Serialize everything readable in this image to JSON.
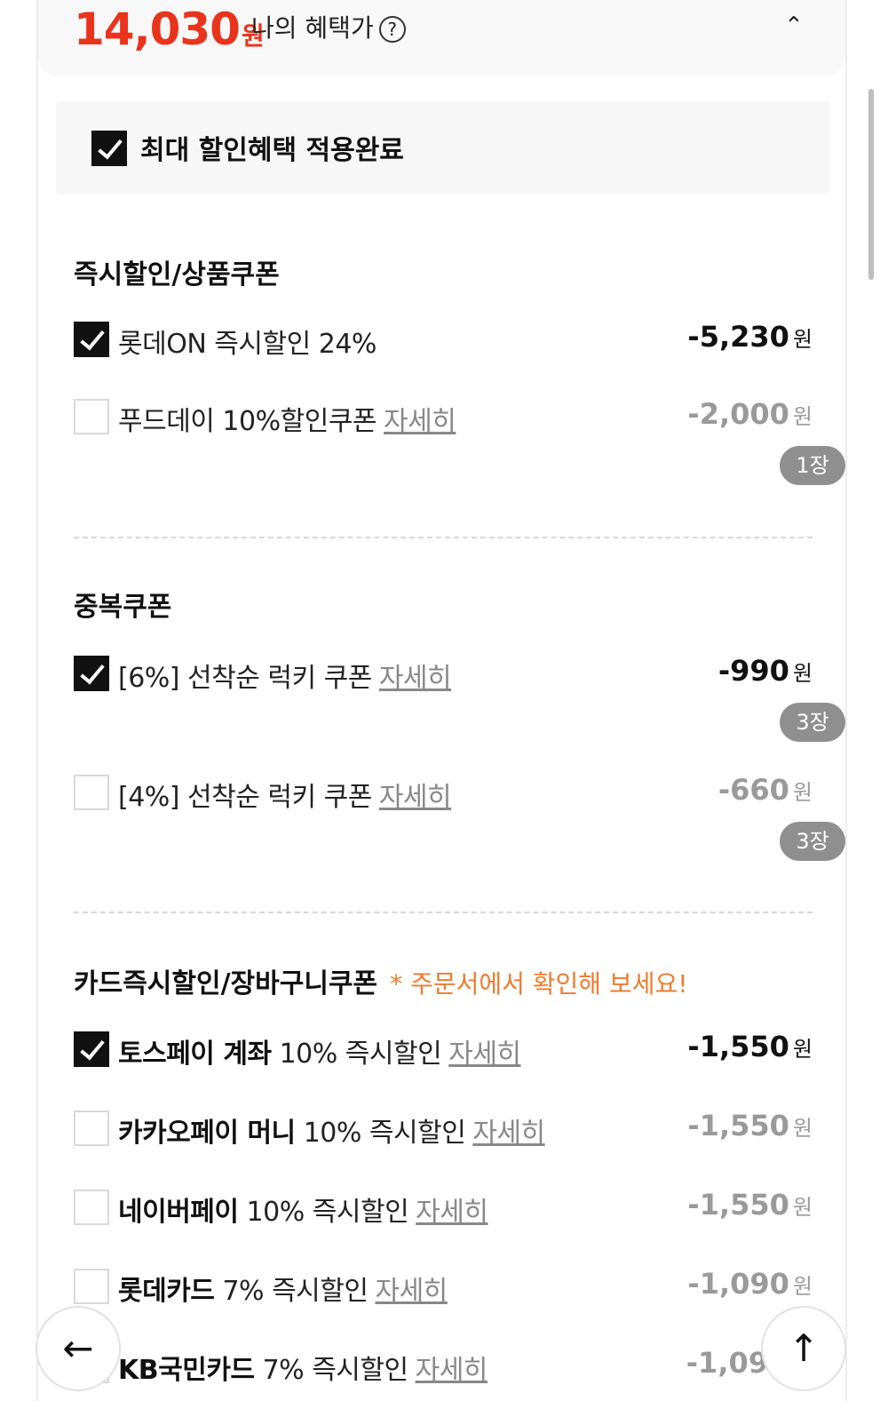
{
  "summary": {
    "price": "14,030",
    "price_unit": "원",
    "benefit_label": "나의 혜택가",
    "help_icon": "?",
    "collapse_icon": "⌃"
  },
  "max_benefit": {
    "label": "최대 할인혜택 적용완료",
    "checked": true
  },
  "sections": {
    "instant": {
      "title": "즉시할인/상품쿠폰",
      "items": [
        {
          "label": "롯데ON 즉시할인 24%",
          "amount": "-5,230",
          "unit": "원",
          "checked": true
        },
        {
          "label": "푸드데이 10%할인쿠폰",
          "detail": "자세히",
          "amount": "-2,000",
          "unit": "원",
          "checked": false,
          "qty": "1장"
        }
      ]
    },
    "duplicate": {
      "title": "중복쿠폰",
      "items": [
        {
          "label": "[6%] 선착순 럭키 쿠폰",
          "detail": "자세히",
          "amount": "-990",
          "unit": "원",
          "checked": true,
          "qty": "3장"
        },
        {
          "label": "[4%] 선착순 럭키 쿠폰",
          "detail": "자세히",
          "amount": "-660",
          "unit": "원",
          "checked": false,
          "qty": "3장"
        }
      ]
    },
    "card": {
      "title": "카드즉시할인/장바구니쿠폰",
      "note": "* 주문서에서 확인해 보세요!",
      "items": [
        {
          "brand": "토스페이 계좌",
          "label": "10% 즉시할인",
          "detail": "자세히",
          "amount": "-1,550",
          "unit": "원",
          "checked": true
        },
        {
          "brand": "카카오페이 머니",
          "label": "10% 즉시할인",
          "detail": "자세히",
          "amount": "-1,550",
          "unit": "원",
          "checked": false
        },
        {
          "brand": "네이버페이",
          "label": "10% 즉시할인",
          "detail": "자세히",
          "amount": "-1,550",
          "unit": "원",
          "checked": false
        },
        {
          "brand": "롯데카드",
          "label": "7% 즉시할인",
          "detail": "자세히",
          "amount": "-1,090",
          "unit": "원",
          "checked": false
        },
        {
          "brand": "KB국민카드",
          "label": "7% 즉시할인",
          "detail": "자세히",
          "amount": "-1,09",
          "unit": "",
          "checked": false
        }
      ]
    }
  },
  "nav": {
    "back_icon": "←",
    "top_icon": "↑"
  },
  "colors": {
    "price": "#e8341c",
    "note": "#f07a2c",
    "checkbox_checked": "#111111",
    "qty_badge": "#8f8f8f"
  }
}
